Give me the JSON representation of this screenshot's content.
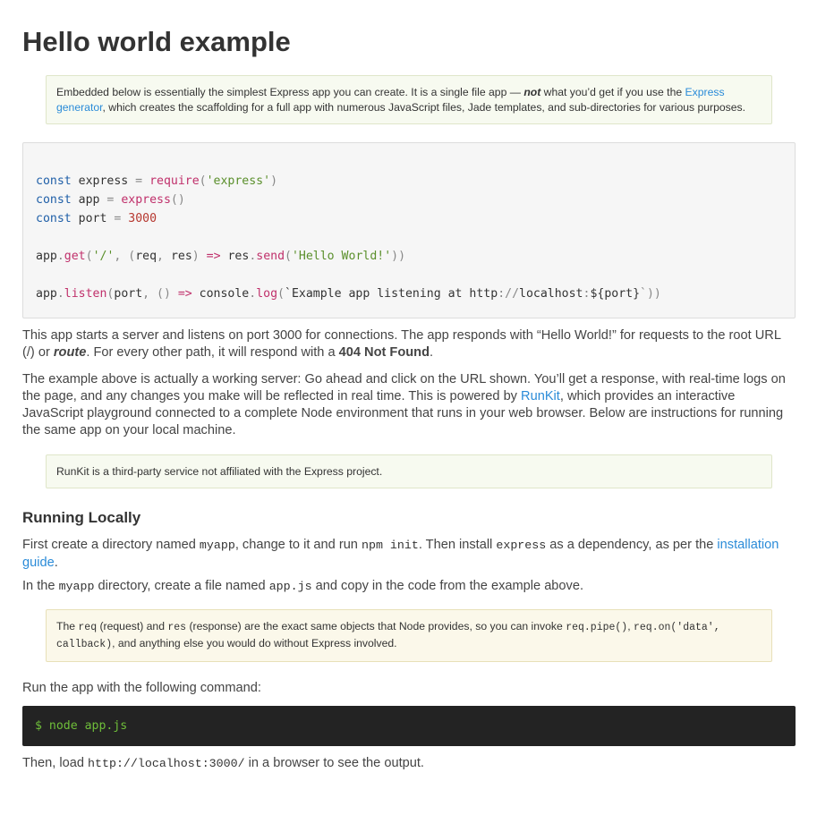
{
  "title": "Hello world example",
  "intro_note": {
    "t1": "Embedded below is essentially the simplest Express app you can create. It is a single file app — ",
    "not": "not",
    "t2": " what you’d get if you use the ",
    "link": "Express generator",
    "t3": ", which creates the scaffolding for a full app with numerous JavaScript files, Jade templates, and sub-directories for various purposes."
  },
  "code": {
    "l1": [
      "const",
      " express ",
      "=",
      " ",
      "require",
      "(",
      "'express'",
      ")"
    ],
    "l2": [
      "const",
      " app ",
      "=",
      " ",
      "express",
      "()"
    ],
    "l3": [
      "const",
      " port ",
      "=",
      " ",
      "3000"
    ],
    "l5": [
      "app",
      ".",
      "get",
      "(",
      "'/'",
      ", (",
      "req",
      ", ",
      "res",
      ") ",
      "=>",
      " res",
      ".",
      "send",
      "(",
      "'Hello World!'",
      "))"
    ],
    "l7": [
      "app",
      ".",
      "listen",
      "(",
      "port",
      ", () ",
      "=>",
      " console",
      ".",
      "log",
      "(",
      "`Example app listening at http",
      "://",
      "localhost",
      ":",
      "${",
      "port",
      "}",
      "`))"
    ]
  },
  "p1": {
    "t1": "This app starts a server and listens on port 3000 for connections. The app responds with “Hello World!” for requests to the root URL (/) or ",
    "route": "route",
    "t2": ". For every other path, it will respond with a ",
    "bold": "404 Not Found",
    "t3": "."
  },
  "p2": {
    "t1": "The example above is actually a working server: Go ahead and click on the URL shown. You’ll get a response, with real-time logs on the page, and any changes you make will be reflected in real time. This is powered by ",
    "link": "RunKit",
    "t2": ", which provides an interactive JavaScript playground connected to a complete Node environment that runs in your web browser. Below are instructions for running the same app on your local machine."
  },
  "runkit_note": "RunKit is a third-party service not affiliated with the Express project.",
  "running_locally": "Running Locally",
  "p3": {
    "t1": "First create a directory named ",
    "c1": "myapp",
    "t2": ", change to it and run ",
    "c2": "npm init",
    "t3": ". Then install ",
    "c3": "express",
    "t4": " as a dependency, as per the ",
    "link": "installation guide",
    "t5": "."
  },
  "p4": {
    "t1": "In the ",
    "c1": "myapp",
    "t2": " directory, create a file named ",
    "c2": "app.js",
    "t3": " and copy in the code from the example above."
  },
  "req_note": {
    "t1": "The ",
    "c1": "req",
    "t2": " (request) and ",
    "c2": "res",
    "t3": " (response) are the exact same objects that Node provides, so you can invoke ",
    "c3": "req.pipe()",
    "t4": ", ",
    "c4": "req.on('data', callback)",
    "t5": ", and anything else you would do without Express involved."
  },
  "p5": "Run the app with the following command:",
  "command": "$ node app.js",
  "p6": {
    "t1": "Then, load ",
    "c1": "http://localhost:3000/",
    "t2": " in a browser to see the output."
  }
}
